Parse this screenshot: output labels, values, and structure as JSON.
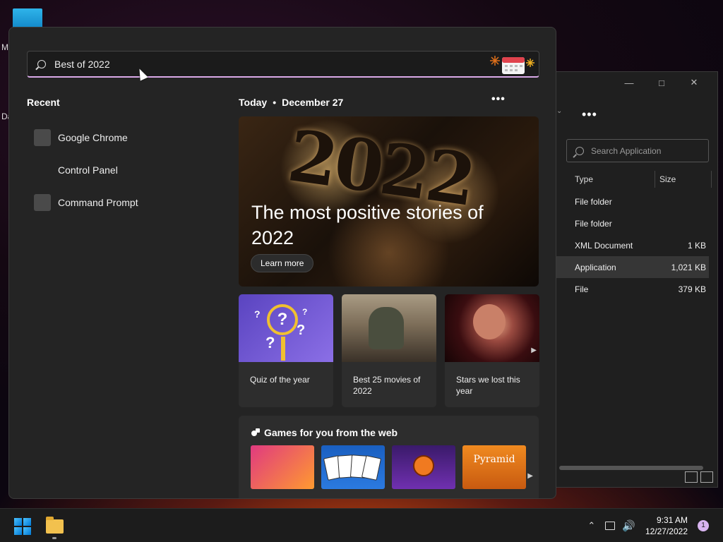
{
  "desktop": {
    "label_m": "M",
    "label_d": "Da"
  },
  "explorer": {
    "search_placeholder": "Search Application",
    "more_label": "•••",
    "columns": {
      "type": "Type",
      "size": "Size"
    },
    "rows": [
      {
        "type": "File folder",
        "size": ""
      },
      {
        "type": "File folder",
        "size": ""
      },
      {
        "type": "XML Document",
        "size": "1 KB"
      },
      {
        "type": "Application",
        "size": "1,021 KB"
      },
      {
        "type": "File",
        "size": "379 KB"
      }
    ]
  },
  "start": {
    "search_value": "Best of 2022",
    "recent": {
      "title": "Recent",
      "items": [
        {
          "label": "Google Chrome",
          "icon": "chrome-icon"
        },
        {
          "label": "Control Panel",
          "icon": "control-panel-icon"
        },
        {
          "label": "Command Prompt",
          "icon": "command-prompt-icon"
        }
      ]
    },
    "today": {
      "label": "Today",
      "separator": "•",
      "date": "December 27",
      "more": "•••"
    },
    "hero": {
      "art_text": "2022",
      "title": "The most positive stories of 2022",
      "button": "Learn more"
    },
    "cards": [
      {
        "caption": "Quiz of the year",
        "icon": "quiz-icon"
      },
      {
        "caption": "Best 25 movies of 2022",
        "icon": "movie-icon"
      },
      {
        "caption": "Stars we lost this year",
        "icon": "star-icon"
      }
    ],
    "games": {
      "title": "Games for you from the web",
      "tiles": [
        {
          "name": "racing-game"
        },
        {
          "name": "solitaire-game"
        },
        {
          "name": "basketball-game"
        },
        {
          "name": "pyramid-game",
          "label": "Pyramid"
        }
      ]
    }
  },
  "taskbar": {
    "time": "9:31 AM",
    "date": "12/27/2022",
    "notifications": "1"
  }
}
